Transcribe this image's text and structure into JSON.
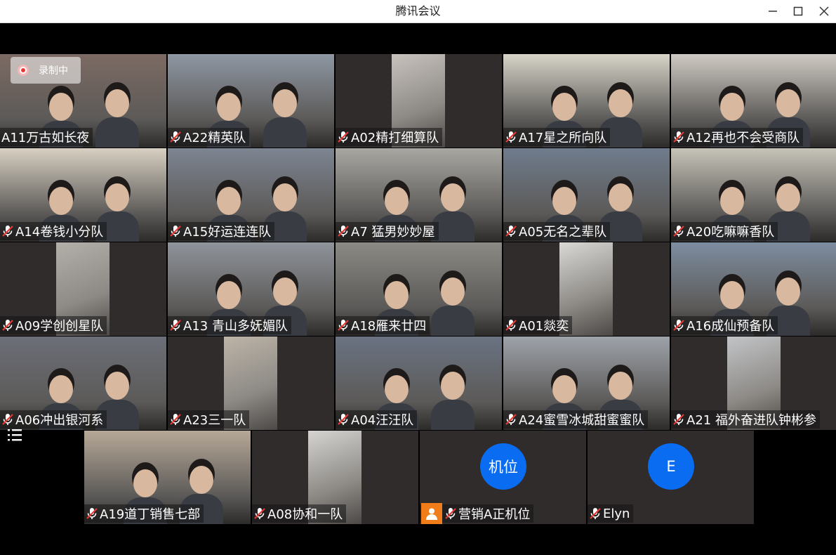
{
  "window": {
    "title": "腾讯会议"
  },
  "recording": {
    "label": "录制中"
  },
  "participants": [
    {
      "name": "A11万古如长夜",
      "muted": false,
      "scene": "room",
      "color": "#7c6a63"
    },
    {
      "name": "A22精英队",
      "muted": true,
      "scene": "lab",
      "color": "#8e97a3"
    },
    {
      "name": "A02精打细算队",
      "muted": true,
      "scene": "portrait",
      "color": "#c8c2bd"
    },
    {
      "name": "A17星之所向队",
      "muted": true,
      "scene": "classroom",
      "color": "#d7d4c8"
    },
    {
      "name": "A12再也不会受商队",
      "muted": true,
      "scene": "lab",
      "color": "#cfcac3"
    },
    {
      "name": "A14卷钱小分队",
      "muted": true,
      "scene": "classroom",
      "color": "#d8d0c2"
    },
    {
      "name": "A15好运连连队",
      "muted": true,
      "scene": "room",
      "color": "#7d8592"
    },
    {
      "name": "A7 猛男妙妙屋",
      "muted": true,
      "scene": "room",
      "color": "#a9a7a2"
    },
    {
      "name": "A05无名之辈队",
      "muted": true,
      "scene": "room",
      "color": "#6f7c8d"
    },
    {
      "name": "A20吃嘛嘛香队",
      "muted": true,
      "scene": "room",
      "color": "#c6c3b8"
    },
    {
      "name": "A09学创创星队",
      "muted": true,
      "scene": "portrait",
      "color": "#b3b0aa"
    },
    {
      "name": "A13 青山多妩媚队",
      "muted": true,
      "scene": "room",
      "color": "#8f949b"
    },
    {
      "name": "A18雁来廿四",
      "muted": true,
      "scene": "room",
      "color": "#8b8a84"
    },
    {
      "name": "A01燚奕",
      "muted": true,
      "scene": "portrait",
      "color": "#d9d8d4"
    },
    {
      "name": "A16成仙预备队",
      "muted": true,
      "scene": "room",
      "color": "#7d8da0"
    },
    {
      "name": "A06冲出银河系",
      "muted": true,
      "scene": "room",
      "color": "#6c6f78"
    },
    {
      "name": "A23三一队",
      "muted": true,
      "scene": "portrait",
      "color": "#bdb4a7"
    },
    {
      "name": "A04汪汪队",
      "muted": true,
      "scene": "lab",
      "color": "#6a7382"
    },
    {
      "name": "A24蜜雪冰城甜蜜蜜队",
      "muted": true,
      "scene": "lab",
      "color": "#9ea3aa"
    },
    {
      "name": "A21 福外奋进队钟彬参",
      "muted": true,
      "scene": "portrait",
      "color": "#c2c4c7"
    },
    {
      "name": "A19道丁销售七部",
      "muted": true,
      "scene": "room",
      "color": "#b6a897"
    },
    {
      "name": "A08协和一队",
      "muted": true,
      "scene": "portrait",
      "color": "#d5d4d0"
    },
    {
      "name": "营销A正机位",
      "muted": true,
      "scene": "avatar",
      "avatar_text": "机位",
      "host": true,
      "color": "#2f2c2b"
    },
    {
      "name": "Elyn",
      "muted": true,
      "scene": "avatar",
      "avatar_text": "E",
      "color": "#2f2c2b"
    }
  ],
  "icons": {
    "mic_muted": "mic-muted-icon",
    "host": "host-person-icon",
    "participant_list": "participant-list-icon",
    "minimize": "minimize-icon",
    "maximize": "maximize-icon",
    "close": "close-icon"
  },
  "colors": {
    "avatar_blue": "#0a6cf1",
    "host_orange": "#f07d1a",
    "tile_bg": "#2f2c2b",
    "mute_red": "#e53935"
  }
}
